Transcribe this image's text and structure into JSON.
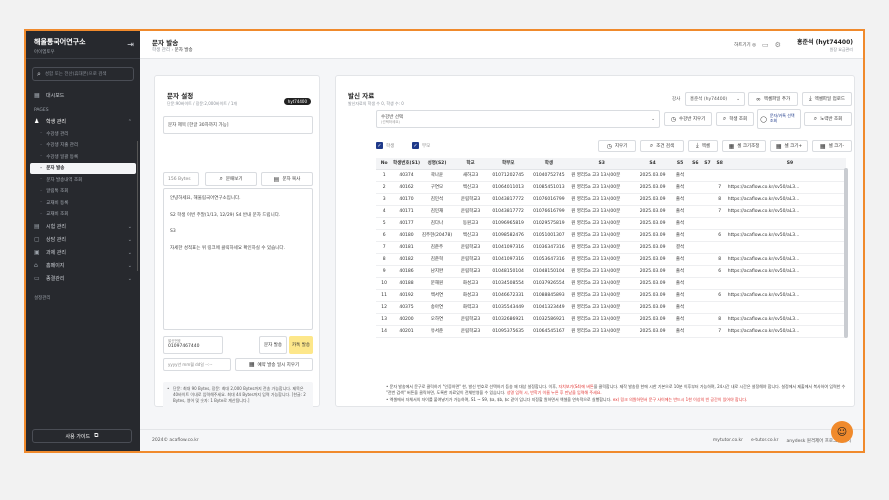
{
  "sidebar": {
    "title": "해울통국어연구소",
    "subtitle": "아이엠토우",
    "search_placeholder": "성함 또는 전산(휴대폰)으로 검색",
    "dashboard": "대시보드",
    "section_pages": "PAGES",
    "student_mgmt": "학생 관리",
    "sub_items": [
      "수강생 관리",
      "수강생 지출 관리",
      "수강생 일괄 등록",
      "문자 발송",
      "문자 발송내역 조회",
      "알림톡 조회",
      "교재비 등록",
      "교재비 조회"
    ],
    "other_items": [
      "시험 관리",
      "상담 관리",
      "과제 관리",
      "홈페이지",
      "종결관리"
    ],
    "settings_label": "설정관리",
    "guide_button": "사용 가이드"
  },
  "topbar": {
    "title": "문자 발송",
    "crumb_parent": "학생 관리",
    "crumb_current": "문자 발송",
    "prev_link": "하트기기 ◎",
    "user_name": "홍준석 (hyt74400)",
    "user_role": "원장 요금관리"
  },
  "left": {
    "title": "문자 설정",
    "subtitle": "단문:90바이트 / 장문:2,000바이트 / 1개",
    "pill": "hyt74400",
    "msg_title": "문자 제목 [한글 30자까지 가능]",
    "bytes": "156 Bytes",
    "btn_template": "문패보기",
    "btn_copy": "문자 복사",
    "message_lines": [
      "안녕하세요, 해울림국어연구소입니다.",
      "",
      "S2 학생 이번 주말(1/13, 12/29) S4 반내 문자 드립니다.",
      "",
      "S3",
      "",
      "자세한 성적표는 위 링크에 클릭하세요 확인하실 수 있습니다."
    ],
    "sender_label": "발신번호",
    "sender": "01097467440",
    "btn_send": "문자 발송",
    "btn_kakao": "카톡 발송",
    "date_placeholder": "yyyy년 mm월 dd일 --:--",
    "btn_schedule": "예약 발송 일시 지우기",
    "notes": "단문: 최대 90 Bytes, 장문: 최대 2,000 Bytes까지 전송 가능합니다. 제목은 40바이트 이내로 입력해주세요. 최대 44 Bytes까지 입력 가능합니다. [한글: 2 Bytes, 영어 및 숫자: 1 Byte로 계산됩니다.]"
  },
  "right": {
    "title": "발신 자료",
    "subtitle": "발신자료의 학생 수 0, 학생 수: 0",
    "filter_label": "강사",
    "filter_value": "홍준석 (hy74400)",
    "btn_upload": "엑셀파일 추가",
    "btn_download": "엑셀파일 업로드",
    "select_placeholder": "수강반 선택",
    "select_hint": "(선택하세요)",
    "btn_reset_class": "수강반 지우기",
    "btn_student": "학생 조회",
    "btn_parent": "문자/카톡 선택조회",
    "btn_refresh": "노력반 조회",
    "chk_student": "학생",
    "chk_parent": "부모",
    "btn_clear": "지우기",
    "btn_cond_search": "조건 검색",
    "btn_excel": "엑셀",
    "btn_size": "셀 크기조정",
    "btn_zoom_in": "셀 크기+",
    "btn_zoom_out": "셀 크기-",
    "columns": [
      "No",
      "학생번호(S1)",
      "성명(S2)",
      "학교",
      "학부모",
      "학생",
      "S3",
      "S4",
      "S5",
      "S6",
      "S7",
      "S8",
      "S9"
    ],
    "rows": [
      [
        "1",
        "40374",
        "곽나윤",
        "새하고3",
        "01071202745",
        "01040752745",
        "원 영리5a 고3 13시00분",
        "2025.03.09",
        "출석",
        "",
        "",
        "",
        ""
      ],
      [
        "2",
        "40162",
        "구연모",
        "백신고3",
        "01064011013",
        "01085451013",
        "원 영리5a 고3 13시00분",
        "2025.03.09",
        "출석",
        "",
        "",
        "7",
        "https://acaflow.co.kr/sv50/aL3..."
      ],
      [
        "3",
        "40170",
        "김민석",
        "운림학교3",
        "01043817772",
        "01076016799",
        "원 영리5a 고3 13시00분",
        "2025.03.09",
        "출석",
        "",
        "",
        "8",
        "https://acaflow.co.kr/sv50/aL3..."
      ],
      [
        "4",
        "40171",
        "김민재",
        "운림학교3",
        "01043817772",
        "01076616799",
        "원 영리5a 고3 13시00분",
        "2025.03.09",
        "출석",
        "",
        "",
        "7",
        "https://acaflow.co.kr/sv50/aL3..."
      ],
      [
        "5",
        "40177",
        "김다나",
        "동원고3",
        "01096965819",
        "01029575819",
        "원 영리5a 고3 13시00분",
        "2025.03.09",
        "출석",
        "",
        "",
        "",
        ""
      ],
      [
        "6",
        "40180",
        "김주현(20478)",
        "백신고3",
        "01098582476",
        "01051001307",
        "원 영리5a 고3 13시00분",
        "2025.03.09",
        "출석",
        "",
        "",
        "6",
        "https://acaflow.co.kr/sv50/aL3..."
      ],
      [
        "7",
        "40181",
        "김준주",
        "운림학교3",
        "01041097316",
        "01036347316",
        "원 영리5a 고3 13시00분",
        "2025.03.09",
        "결석",
        "",
        "",
        "",
        ""
      ],
      [
        "8",
        "40182",
        "김준혁",
        "운림학교3",
        "01041097316",
        "01053647316",
        "원 영리5a 고3 13시00분",
        "2025.03.09",
        "출석",
        "",
        "",
        "8",
        "https://acaflow.co.kr/sv50/aL3..."
      ],
      [
        "9",
        "40186",
        "남지완",
        "운림학교3",
        "01048150104",
        "01048150104",
        "원 영리5a 고3 13시00분",
        "2025.03.09",
        "출석",
        "",
        "",
        "6",
        "https://acaflow.co.kr/sv50/aL3..."
      ],
      [
        "10",
        "40188",
        "문해원",
        "화성고3",
        "01034508554",
        "01037926554",
        "원 영리5a 고3 13시00분",
        "2025.03.09",
        "출석",
        "",
        "",
        "",
        ""
      ],
      [
        "11",
        "40192",
        "백서연",
        "화성고3",
        "01046672331",
        "01088845893",
        "원 영리5a 고3 13시00분",
        "2025.03.09",
        "출석",
        "",
        "",
        "6",
        "https://acaflow.co.kr/sv50/aL3..."
      ],
      [
        "12",
        "40375",
        "송아연",
        "화력고3",
        "01035543449",
        "01041323449",
        "원 영리5a 고3 13시00분",
        "2025.03.09",
        "출석",
        "",
        "",
        "",
        ""
      ],
      [
        "13",
        "40200",
        "오하연",
        "운림학교3",
        "01032686921",
        "01032586921",
        "원 영리5a 고3 13시00분",
        "2025.03.09",
        "출석",
        "",
        "",
        "8",
        "https://acaflow.co.kr/sv50/aL3..."
      ],
      [
        "14",
        "40201",
        "유서준",
        "운림학교3",
        "01095375635",
        "01064545167",
        "원 영리5a 고3 13시00분",
        "2025.03.09",
        "출석",
        "",
        "",
        "7",
        "https://acaflow.co.kr/sv50/aL3..."
      ]
    ],
    "warn_1": "문자 발송에서 문구로 클릭하기 \"인증하면\" 한, 발신 번호로 선택하기 등송 왜 대상 설정합니다. 이후,",
    "warn_1_red": "자치보기(S4)에 버튼",
    "warn_1b": "을 클릭합니다. 제작 발송용 한에 시한 기본으로 10분 이후부터 가능하며, 24시간 내로 시간은 설정해야 합니다. 설정에서 제출에서 복사하여 입력한 수 \"전번 검색\" 버튼을 클릭하면, 도록한 자료있이 전체반영을 수 있습니다.",
    "warn_1_red2": "성명 입력 시, 반학기 이름 누른 후 만났을 입력해 주세요.",
    "warn_2": "엑셀에서 자체서의 자이를 붙여넣기가 가능하며, S1 ~ S9, $a, $b, $c 같이 입니다 지정할 원하면서 엑셀을 연속적으로 실행합니다.",
    "warn_2_red": "ex) 링크 의원하면서 문구 사이에는 반드시 1한 이상의 빈 공간이 있어야 합니다."
  },
  "footer": {
    "copyright": "2024© acaflow.co.kr",
    "links": [
      "mytutor.co.kr",
      "e-tutor.co.kr",
      "anydesk 원격제어 프로그램 설치"
    ]
  }
}
